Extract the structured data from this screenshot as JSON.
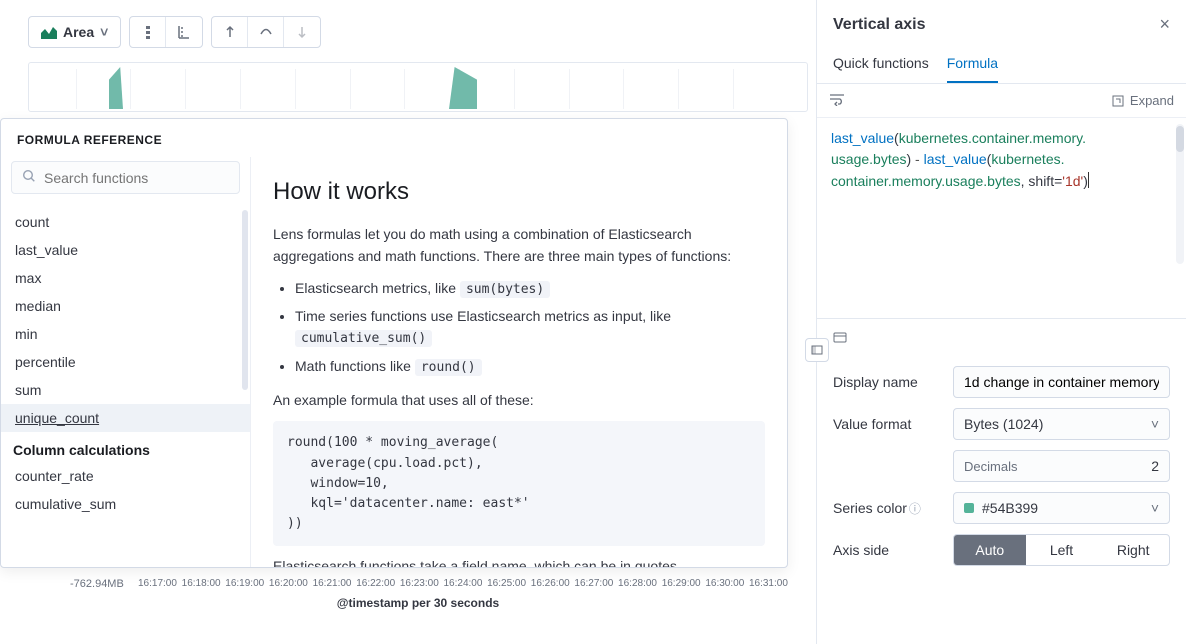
{
  "toolbar": {
    "viz_label": "Area"
  },
  "chart": {
    "ytick": "-762.94MB",
    "xticks": [
      "16:17:00",
      "16:18:00",
      "16:19:00",
      "16:20:00",
      "16:21:00",
      "16:22:00",
      "16:23:00",
      "16:24:00",
      "16:25:00",
      "16:26:00",
      "16:27:00",
      "16:28:00",
      "16:29:00",
      "16:30:00",
      "16:31:00"
    ],
    "xlabel": "@timestamp per 30 seconds"
  },
  "popover": {
    "title": "FORMULA REFERENCE",
    "search_placeholder": "Search functions",
    "functions": [
      "count",
      "last_value",
      "max",
      "median",
      "min",
      "percentile",
      "sum",
      "unique_count"
    ],
    "selected": "unique_count",
    "section2_title": "Column calculations",
    "section2_items": [
      "counter_rate",
      "cumulative_sum"
    ],
    "doc": {
      "heading": "How it works",
      "p1": "Lens formulas let you do math using a combination of Elasticsearch aggregations and math functions. There are three main types of functions:",
      "li1a": "Elasticsearch metrics, like ",
      "li1b": "sum(bytes)",
      "li2a": "Time series functions use Elasticsearch metrics as input, like ",
      "li2b": "cumulative_sum()",
      "li3a": "Math functions like ",
      "li3b": "round()",
      "p2": "An example formula that uses all of these:",
      "code": "round(100 * moving_average(\n   average(cpu.load.pct),\n   window=10,\n   kql='datacenter.name: east*'\n))",
      "p3": "Elasticsearch functions take a field name, which can be in quotes."
    }
  },
  "panel": {
    "title": "Vertical axis",
    "tabs": {
      "quick": "Quick functions",
      "formula": "Formula"
    },
    "expand": "Expand",
    "formula_parts": {
      "fn1": "last_value",
      "paren1": "(",
      "field1": "kubernetes.container.memory.\nusage.bytes",
      "close1": ")",
      "op": " - ",
      "fn2": "last_value",
      "paren2": "(",
      "field2": "kubernetes.\ncontainer.memory.usage.bytes",
      "comma": ", shift=",
      "str": "'1d'",
      "close2": ")"
    },
    "settings": {
      "display_name_label": "Display name",
      "display_name_value": "1d change in container memory",
      "value_format_label": "Value format",
      "value_format_value": "Bytes (1024)",
      "decimals_label": "Decimals",
      "decimals_value": "2",
      "series_color_label": "Series color",
      "series_color_value": "#54B399",
      "axis_side_label": "Axis side",
      "axis_side_options": [
        "Auto",
        "Left",
        "Right"
      ],
      "axis_side_selected": "Auto"
    }
  }
}
